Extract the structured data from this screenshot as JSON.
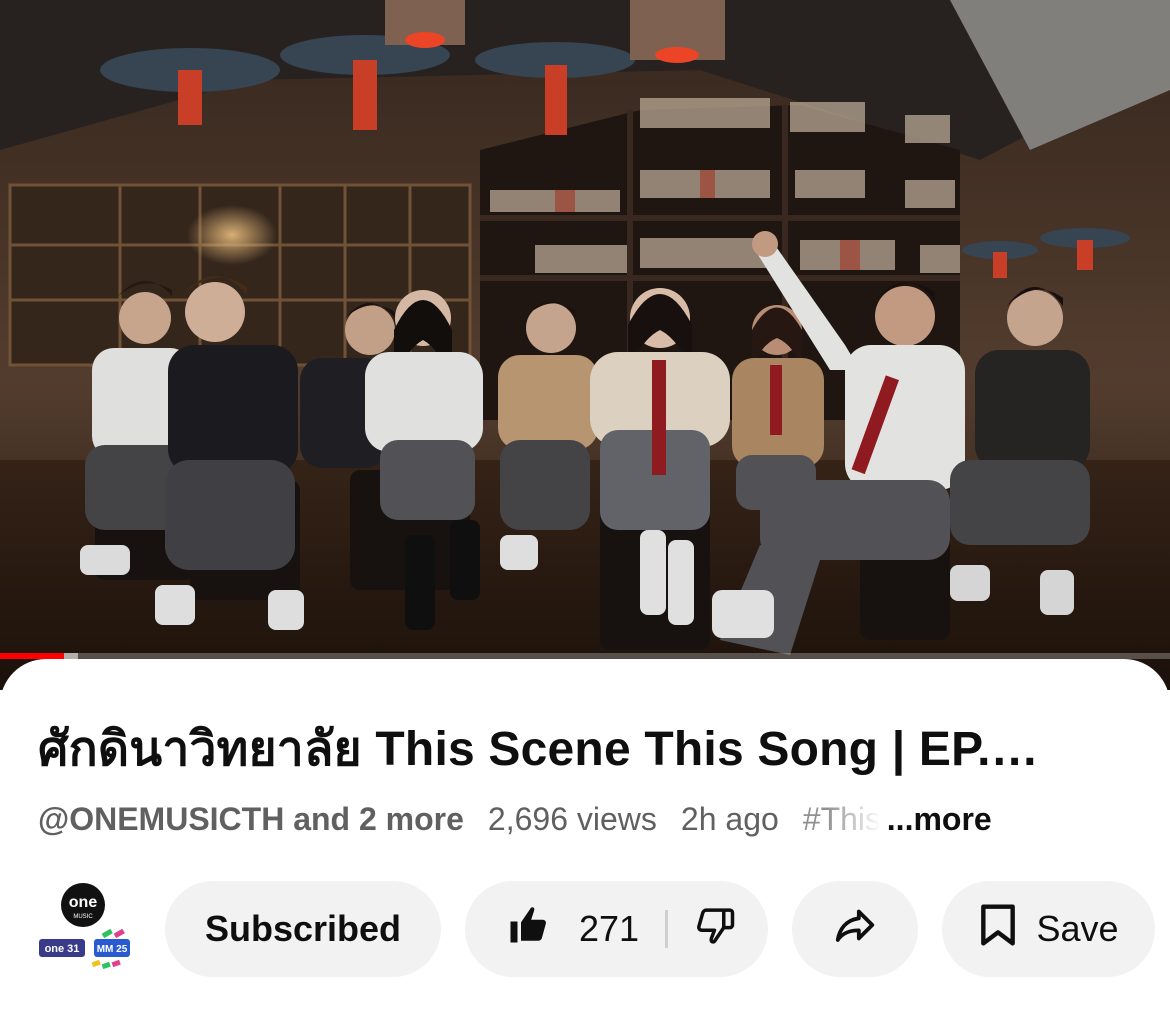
{
  "video": {
    "progress_fraction": 0.055,
    "buffer_fraction": 0.012
  },
  "info": {
    "title": "ศักดินาวิทยาลัย This Scene This Song | EP.…",
    "channel": "@ONEMUSICTH and 2 more",
    "views": "2,696 views",
    "age": "2h ago",
    "hashtag": "#This",
    "more_label": "...more"
  },
  "channel_logo": {
    "brand": "one",
    "sub": "MUSIC",
    "tags": [
      "one 31",
      "MM 25"
    ]
  },
  "actions": {
    "subscribed_label": "Subscribed",
    "like_count": "271",
    "save_label": "Save"
  },
  "icons": {
    "like": "thumbs-up-icon",
    "dislike": "thumbs-down-icon",
    "share": "share-arrow-icon",
    "save": "bookmark-icon"
  },
  "colors": {
    "progress": "#ff0000",
    "pill_bg": "#f2f2f2",
    "text_primary": "#0f0f0f",
    "text_secondary": "#606060"
  }
}
